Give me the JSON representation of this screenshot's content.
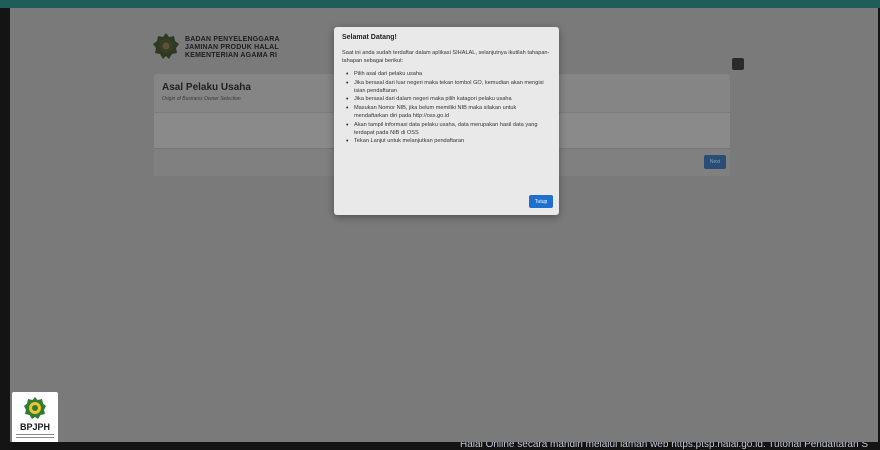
{
  "background_app": {
    "org_name_lines": [
      "BADAN PENYELENGGARA",
      "JAMINAN PRODUK HALAL",
      "KEMENTERIAN AGAMA RI"
    ],
    "card_title": "Asal Pelaku Usaha",
    "card_subtitle": "Origin of Business Owner Selection",
    "next_button_label": "Next"
  },
  "modal": {
    "title": "Selamat Datang!",
    "intro": "Saat ini anda sudah terdaftar dalam aplikasi SIHALAL, selanjutnya ikutilah tahapan-tahapan sebagai berikut:",
    "steps": [
      "Pilih asal dari pelaku usaha",
      "Jika berasal dari luar negeri maka tekan tombol GO, kemudian akan mengisi isian pendaftaran",
      "Jika berasal dari dalam negeri maka pilih katagori pelaku usaha",
      "Masukan Nomor NIB, jika belum memiliki NIB maka silakan untuk mendaftarkan diri pada http://oss.go.id",
      "Akan tampil informasi data pelaku usaha, data merupakan hasil data yang terdapat pada NIB di OSS",
      "Tekan Lanjut untuk melanjutkan pendaftaran"
    ],
    "close_label": "Tutup"
  },
  "corner_logo": {
    "text": "BPJPH"
  },
  "ticker": {
    "text": "Halal Online secara mandiri melalui laman web https:ptsp.halal.go.id. Tutorial Pendaftaran S"
  },
  "colors": {
    "accent": "#1f6fd1",
    "brand_green": "#1e5e57",
    "overlay": "#7a7a7a"
  }
}
